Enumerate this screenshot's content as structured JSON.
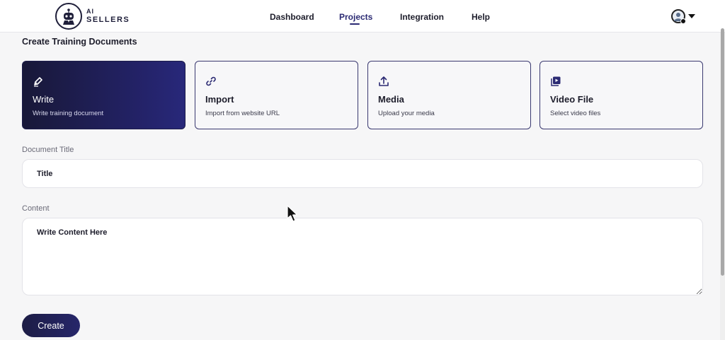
{
  "header": {
    "logo": {
      "line1": "AI",
      "line2": "SELLERS"
    },
    "nav": [
      {
        "label": "Dashboard",
        "active": false
      },
      {
        "label": "Projects",
        "active": true
      },
      {
        "label": "Integration",
        "active": false
      },
      {
        "label": "Help",
        "active": false
      }
    ],
    "profile_icon": "avatar-icon"
  },
  "page": {
    "section_title": "Create Training Documents"
  },
  "cards": [
    {
      "title": "Write",
      "subtitle": "Write training document",
      "icon": "pen-icon",
      "active": true
    },
    {
      "title": "Import",
      "subtitle": "Import from website URL",
      "icon": "link-icon",
      "active": false
    },
    {
      "title": "Media",
      "subtitle": "Upload your media",
      "icon": "upload-icon",
      "active": false
    },
    {
      "title": "Video File",
      "subtitle": "Select video files",
      "icon": "video-icon",
      "active": false
    }
  ],
  "form": {
    "title_label": "Document Title",
    "title_placeholder": "Title",
    "title_value": "",
    "content_label": "Content",
    "content_placeholder": "Write Content Here",
    "content_value": "",
    "submit_label": "Create"
  },
  "colors": {
    "accent": "#2b2a73",
    "active_card_start": "#181838",
    "active_card_end": "#28287a",
    "background": "#f6f6f7"
  }
}
